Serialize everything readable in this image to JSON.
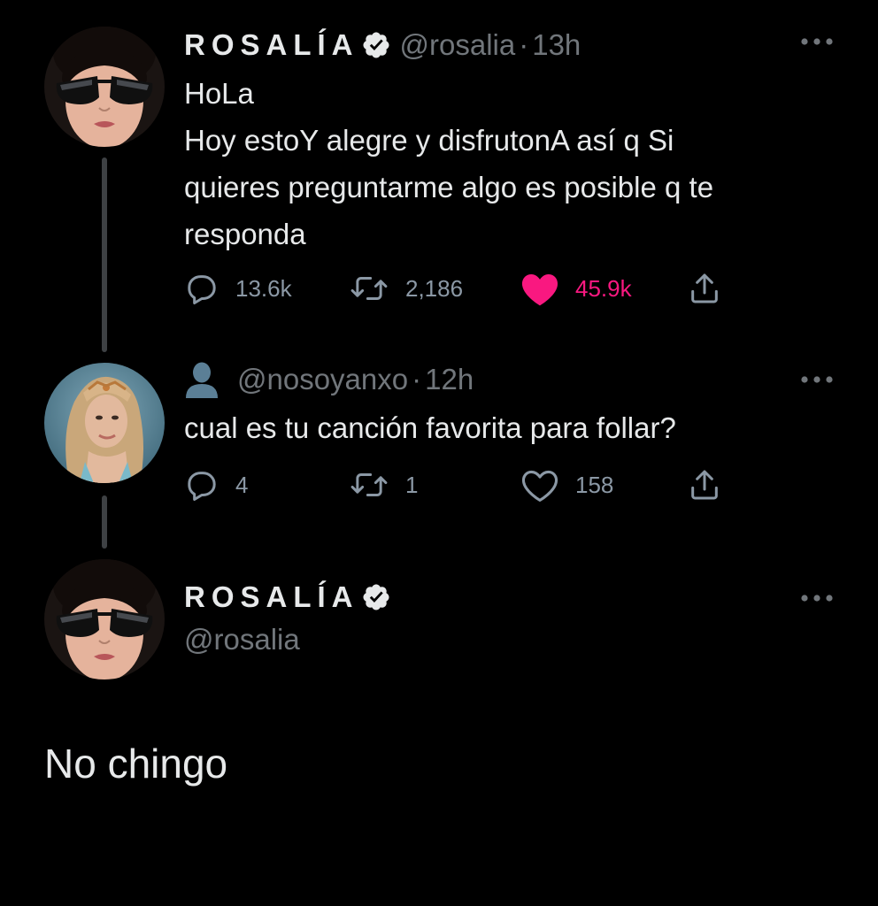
{
  "tweets": [
    {
      "display_name": "ROSALÍA",
      "handle": "@rosalia",
      "separator": "·",
      "time": "13h",
      "text": "HoLa\nHoy estoY alegre y disfrutonA así q Si quieres preguntarme algo es posible q te responda",
      "text_lines": [
        "HoLa",
        "Hoy estoY alegre y disfrutonA así q Si",
        "quieres preguntarme algo es posible q te",
        "responda"
      ],
      "reply_count": "13.6k",
      "retweet_count": "2,186",
      "like_count": "45.9k",
      "liked": true
    },
    {
      "display_name": "",
      "handle": "@nosoyanxo",
      "separator": "·",
      "time": "12h",
      "text": "cual es tu canción favorita para follar?",
      "reply_count": "4",
      "retweet_count": "1",
      "like_count": "158",
      "liked": false
    }
  ],
  "focused_tweet": {
    "display_name": "ROSALÍA",
    "handle": "@rosalia",
    "text": "No chingo"
  },
  "icons": {
    "verified": "verified-badge-icon",
    "more": "more-icon",
    "reply": "reply-icon",
    "retweet": "retweet-icon",
    "like": "heart-icon",
    "share": "share-icon",
    "default_user": "user-silhouette-icon"
  },
  "colors": {
    "background": "#000000",
    "text": "#e7e9ea",
    "secondary": "#71767b",
    "like": "#f91880",
    "thread_line": "#3e4144"
  }
}
